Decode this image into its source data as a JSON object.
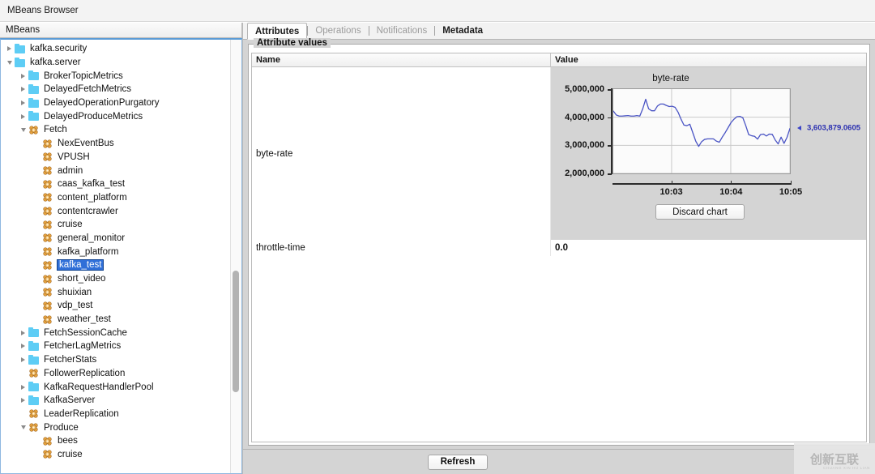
{
  "window": {
    "title": "MBeans Browser"
  },
  "tree_panel": {
    "header": "MBeans",
    "items": [
      {
        "label": "kafka.security",
        "level": 0,
        "icon": "folder-icon",
        "arrow": "collapsed",
        "selected": false
      },
      {
        "label": "kafka.server",
        "level": 0,
        "icon": "folder-icon",
        "arrow": "expanded",
        "selected": false
      },
      {
        "label": "BrokerTopicMetrics",
        "level": 1,
        "icon": "folder-icon",
        "arrow": "collapsed",
        "selected": false
      },
      {
        "label": "DelayedFetchMetrics",
        "level": 1,
        "icon": "folder-icon",
        "arrow": "collapsed",
        "selected": false
      },
      {
        "label": "DelayedOperationPurgatory",
        "level": 1,
        "icon": "folder-icon",
        "arrow": "collapsed",
        "selected": false
      },
      {
        "label": "DelayedProduceMetrics",
        "level": 1,
        "icon": "folder-icon",
        "arrow": "collapsed",
        "selected": false
      },
      {
        "label": "Fetch",
        "level": 1,
        "icon": "mbean-icon",
        "arrow": "expanded",
        "selected": false
      },
      {
        "label": "NexEventBus",
        "level": 2,
        "icon": "mbean-icon",
        "arrow": "none",
        "selected": false
      },
      {
        "label": "VPUSH",
        "level": 2,
        "icon": "mbean-icon",
        "arrow": "none",
        "selected": false
      },
      {
        "label": "admin",
        "level": 2,
        "icon": "mbean-icon",
        "arrow": "none",
        "selected": false
      },
      {
        "label": "caas_kafka_test",
        "level": 2,
        "icon": "mbean-icon",
        "arrow": "none",
        "selected": false
      },
      {
        "label": "content_platform",
        "level": 2,
        "icon": "mbean-icon",
        "arrow": "none",
        "selected": false
      },
      {
        "label": "contentcrawler",
        "level": 2,
        "icon": "mbean-icon",
        "arrow": "none",
        "selected": false
      },
      {
        "label": "cruise",
        "level": 2,
        "icon": "mbean-icon",
        "arrow": "none",
        "selected": false
      },
      {
        "label": "general_monitor",
        "level": 2,
        "icon": "mbean-icon",
        "arrow": "none",
        "selected": false
      },
      {
        "label": "kafka_platform",
        "level": 2,
        "icon": "mbean-icon",
        "arrow": "none",
        "selected": false
      },
      {
        "label": "kafka_test",
        "level": 2,
        "icon": "mbean-icon",
        "arrow": "none",
        "selected": true
      },
      {
        "label": "short_video",
        "level": 2,
        "icon": "mbean-icon",
        "arrow": "none",
        "selected": false
      },
      {
        "label": "shuixian",
        "level": 2,
        "icon": "mbean-icon",
        "arrow": "none",
        "selected": false
      },
      {
        "label": "vdp_test",
        "level": 2,
        "icon": "mbean-icon",
        "arrow": "none",
        "selected": false
      },
      {
        "label": "weather_test",
        "level": 2,
        "icon": "mbean-icon",
        "arrow": "none",
        "selected": false
      },
      {
        "label": "FetchSessionCache",
        "level": 1,
        "icon": "folder-icon",
        "arrow": "collapsed",
        "selected": false
      },
      {
        "label": "FetcherLagMetrics",
        "level": 1,
        "icon": "folder-icon",
        "arrow": "collapsed",
        "selected": false
      },
      {
        "label": "FetcherStats",
        "level": 1,
        "icon": "folder-icon",
        "arrow": "collapsed",
        "selected": false
      },
      {
        "label": "FollowerReplication",
        "level": 1,
        "icon": "mbean-icon",
        "arrow": "none",
        "selected": false
      },
      {
        "label": "KafkaRequestHandlerPool",
        "level": 1,
        "icon": "folder-icon",
        "arrow": "collapsed",
        "selected": false
      },
      {
        "label": "KafkaServer",
        "level": 1,
        "icon": "folder-icon",
        "arrow": "collapsed",
        "selected": false
      },
      {
        "label": "LeaderReplication",
        "level": 1,
        "icon": "mbean-icon",
        "arrow": "none",
        "selected": false
      },
      {
        "label": "Produce",
        "level": 1,
        "icon": "mbean-icon",
        "arrow": "expanded",
        "selected": false
      },
      {
        "label": "bees",
        "level": 2,
        "icon": "mbean-icon",
        "arrow": "none",
        "selected": false
      },
      {
        "label": "cruise",
        "level": 2,
        "icon": "mbean-icon",
        "arrow": "none",
        "selected": false
      }
    ]
  },
  "tabs": [
    {
      "label": "Attributes",
      "state": "active"
    },
    {
      "label": "Operations",
      "state": "disabled"
    },
    {
      "label": "Notifications",
      "state": "disabled"
    },
    {
      "label": "Metadata",
      "state": "enabled"
    }
  ],
  "attributes_panel": {
    "group_title": "Attribute values",
    "columns": [
      "Name",
      "Value"
    ],
    "rows": [
      {
        "name": "byte-rate",
        "value": ""
      },
      {
        "name": "throttle-time",
        "value": "0.0"
      }
    ],
    "discard_chart_label": "Discard chart"
  },
  "bottom_bar": {
    "refresh_label": "Refresh"
  },
  "watermark": {
    "cn": "创新互联",
    "en": "CHUANG XIN HU LIAN"
  },
  "chart_data": {
    "type": "line",
    "title": "byte-rate",
    "xlabel": "",
    "ylabel": "",
    "ylim": [
      2000000,
      5000000
    ],
    "ytick_labels": [
      "5,000,000",
      "4,000,000",
      "3,000,000",
      "2,000,000"
    ],
    "ytick_values": [
      5000000,
      4000000,
      3000000,
      2000000
    ],
    "xtick_labels": [
      "10:03",
      "10:04",
      "10:05"
    ],
    "xtick_positions": [
      0.33,
      0.665,
      1.0
    ],
    "grid": true,
    "legend": null,
    "line_color": "#4a54c4",
    "current_value_label": "3,603,879.0605",
    "current_value": 3603879.0605,
    "series": [
      {
        "name": "byte-rate",
        "values": [
          4220000,
          4080000,
          4040000,
          4040000,
          4050000,
          4060000,
          4040000,
          4040000,
          4060000,
          4040000,
          4300000,
          4640000,
          4300000,
          4230000,
          4230000,
          4400000,
          4470000,
          4470000,
          4420000,
          4380000,
          4390000,
          4350000,
          4180000,
          3930000,
          3720000,
          3700000,
          3750000,
          3450000,
          3150000,
          2960000,
          3130000,
          3210000,
          3230000,
          3230000,
          3230000,
          3150000,
          3110000,
          3290000,
          3450000,
          3630000,
          3810000,
          3930000,
          4020000,
          4030000,
          3980000,
          3700000,
          3380000,
          3340000,
          3320000,
          3220000,
          3380000,
          3400000,
          3330000,
          3400000,
          3390000,
          3190000,
          3050000,
          3290000,
          3070000,
          3280000,
          3600000
        ]
      }
    ]
  }
}
